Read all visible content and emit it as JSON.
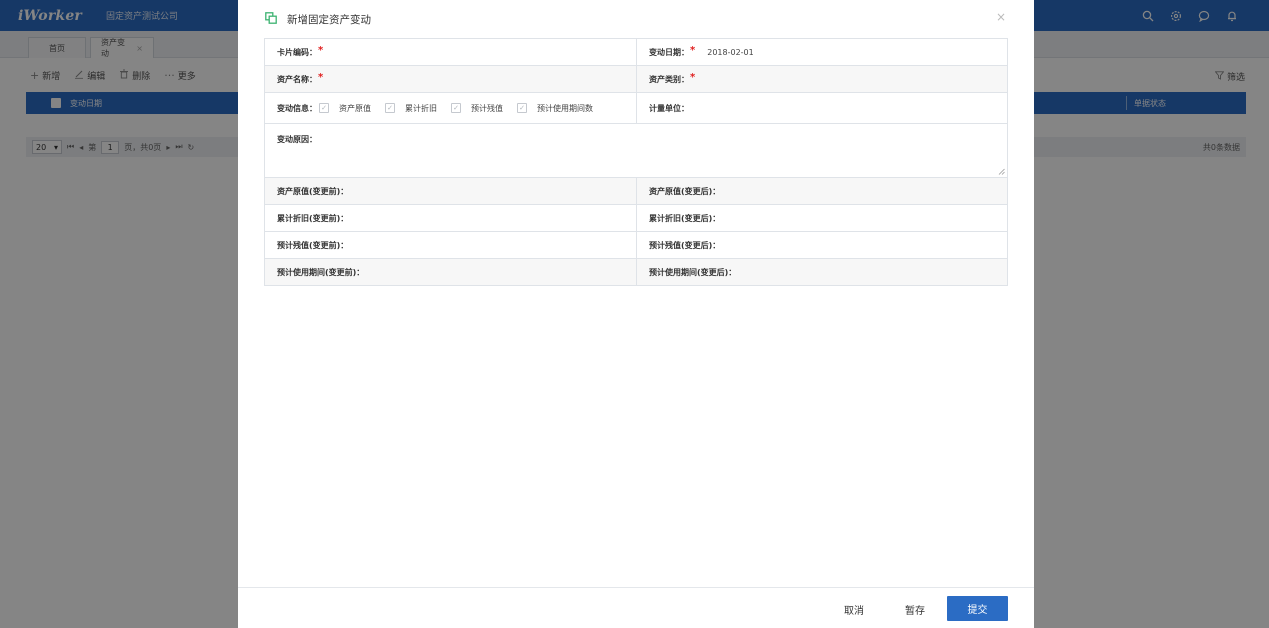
{
  "app": {
    "brand": "iWorker",
    "company": "固定资产测试公司",
    "tabs": [
      {
        "label": "首页"
      },
      {
        "label": "资产变动",
        "close": "×"
      }
    ],
    "toolbar": {
      "add_label": "新增",
      "edit_label": "编辑",
      "delete_label": "删除",
      "more_label": "更多",
      "filter_label": "筛选"
    },
    "grid": {
      "columns": [
        "变动日期",
        "单据状态"
      ]
    },
    "pager": {
      "page_size": "20",
      "page_prefix": "第",
      "page_value": "1",
      "page_suffix": "页，共0页",
      "total": "共0条数据"
    },
    "colors": {
      "accent": "#2b6cc4",
      "required": "#e02020",
      "modal_icon": "#3cb371"
    }
  },
  "modal": {
    "title": "新增固定资产变动",
    "close": "×",
    "fields": {
      "card_code_label": "卡片编码：",
      "change_date_label": "变动日期：",
      "change_date_value": "2018-02-01",
      "asset_name_label": "资产名称：",
      "asset_category_label": "资产类别：",
      "change_info_label": "变动信息：",
      "change_info_options": [
        "资产原值",
        "累计折旧",
        "预计残值",
        "预计使用期间数"
      ],
      "unit_label": "计量单位：",
      "reason_label": "变动原因：",
      "original_before_label": "资产原值(变更前)：",
      "original_after_label": "资产原值(变更后)：",
      "dep_before_label": "累计折旧(变更前)：",
      "dep_after_label": "累计折旧(变更后)：",
      "residual_before_label": "预计残值(变更前)：",
      "residual_after_label": "预计残值(变更后)：",
      "period_before_label": "预计使用期间(变更前)：",
      "period_after_label": "预计使用期间(变更后)："
    },
    "required_mark": "*",
    "footer": {
      "cancel_label": "取消",
      "draft_label": "暂存",
      "submit_label": "提交"
    }
  }
}
